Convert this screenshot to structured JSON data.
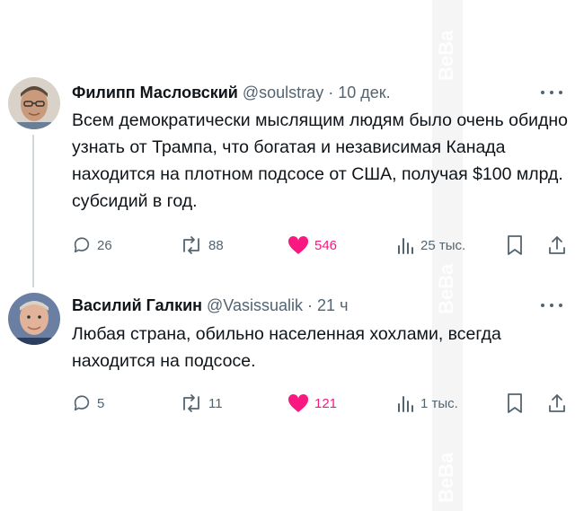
{
  "tweets": [
    {
      "name": "Филипп Масловский",
      "handle": "@soulstray",
      "separator": "·",
      "time": "10 дек.",
      "text": "Всем демократически мыслящим людям было очень обидно узнать от Трампа, что богатая и независимая Канада находится на плотном подсосе от США, получая $100 млрд. субсидий в год.",
      "replies": "26",
      "retweets": "88",
      "likes": "546",
      "views": "25 тыс."
    },
    {
      "name": "Василий Галкин",
      "handle": "@Vasissualik",
      "separator": "·",
      "time": "21 ч",
      "text": "Любая страна, обильно населенная хохлами, всегда находится на подсосе.",
      "replies": "5",
      "retweets": "11",
      "likes": "121",
      "views": "1 тыс."
    }
  ],
  "watermark": "BeBa",
  "colors": {
    "text": "#0f1419",
    "muted": "#536471",
    "like": "#f91880",
    "thread_line": "#cfd9de"
  }
}
